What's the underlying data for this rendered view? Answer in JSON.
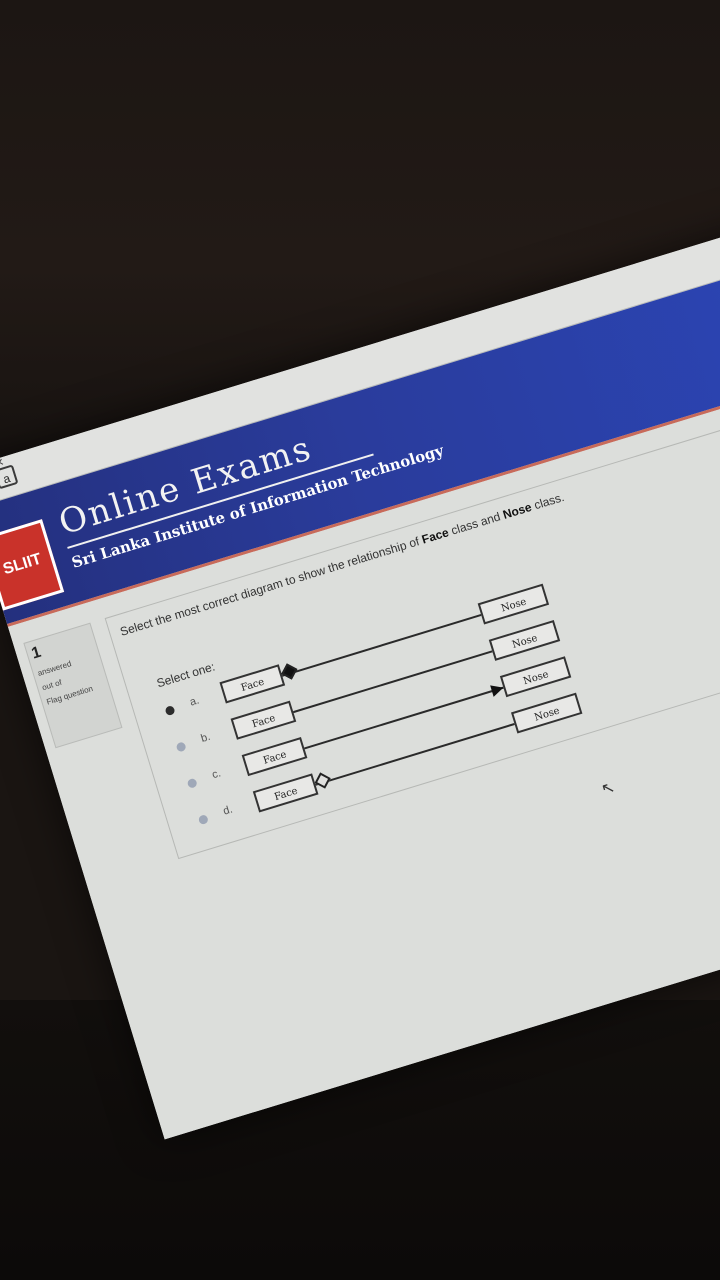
{
  "window": {
    "close_glyph": "×",
    "icon1": "i",
    "icon2": "a"
  },
  "header": {
    "logo_text": "SLIIT",
    "title": "Online Exams",
    "subtitle": "Sri Lanka Institute of Information Technology"
  },
  "question_info": {
    "number": "1",
    "status": "answered",
    "marks": "out of",
    "flag": "Flag question"
  },
  "question": {
    "prefix": "Select the most correct diagram to show the relationship of ",
    "class1": "Face",
    "middle": " class and ",
    "class2": "Nose",
    "suffix": " class.",
    "select_label": "Select one:",
    "options": [
      {
        "letter": "a.",
        "left": "Face",
        "right": "Nose",
        "connector": "filled-diamond",
        "selected": true
      },
      {
        "letter": "b.",
        "left": "Face",
        "right": "Nose",
        "connector": "line",
        "selected": false
      },
      {
        "letter": "c.",
        "left": "Face",
        "right": "Nose",
        "connector": "arrow",
        "selected": false
      },
      {
        "letter": "d.",
        "left": "Face",
        "right": "Nose",
        "connector": "hollow-diamond",
        "selected": false
      }
    ]
  },
  "icons": {
    "cursor": "mouse-pointer-icon"
  }
}
